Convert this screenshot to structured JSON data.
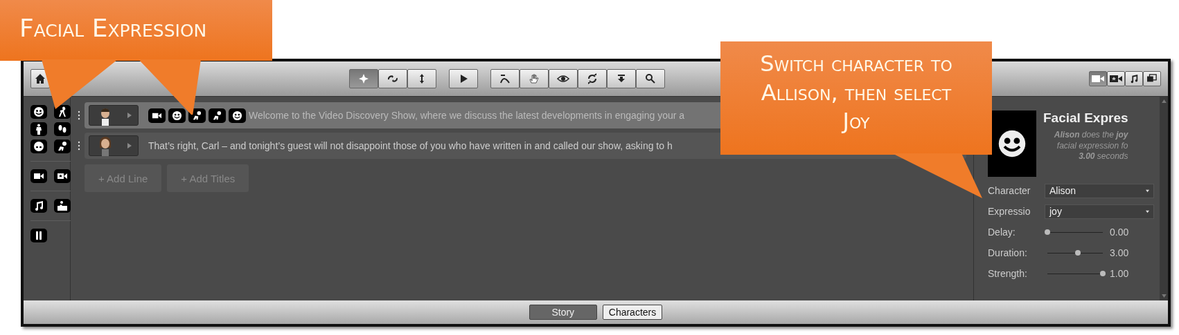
{
  "callouts": [
    {
      "text": "Facial Expression"
    },
    {
      "text": "Switch character to Allison, then select Joy"
    }
  ],
  "toolbar": {
    "mode_buttons": [
      {
        "kind": "move",
        "selected": true
      },
      {
        "kind": "rotate",
        "selected": false
      },
      {
        "kind": "updown",
        "selected": false
      }
    ],
    "view_buttons": [
      {
        "kind": "camera",
        "selected": true
      },
      {
        "kind": "starcam",
        "selected": false
      },
      {
        "kind": "music",
        "selected": false
      },
      {
        "kind": "media",
        "selected": false
      }
    ]
  },
  "palette": [
    {
      "kind": "face"
    },
    {
      "kind": "run"
    },
    {
      "kind": "stand"
    },
    {
      "kind": "steps"
    },
    {
      "kind": "eyes"
    },
    {
      "kind": "crawl"
    },
    {
      "kind": "divider"
    },
    {
      "kind": "camera"
    },
    {
      "kind": "starcam"
    },
    {
      "kind": "divider"
    },
    {
      "kind": "music"
    },
    {
      "kind": "picture"
    },
    {
      "kind": "divider"
    },
    {
      "kind": "pause"
    }
  ],
  "lines": [
    {
      "selected": true,
      "avatar": {
        "kind": "man"
      },
      "actions": [
        {
          "kind": "camera"
        },
        {
          "kind": "face"
        },
        {
          "kind": "crawl"
        },
        {
          "kind": "crawl"
        },
        {
          "kind": "face"
        }
      ],
      "text": "Welcome to the Video Discovery Show, where we discuss the latest developments in engaging your a"
    },
    {
      "selected": false,
      "avatar": {
        "kind": "woman"
      },
      "text": "That’s right, Carl – and tonight’s guest will not disappoint those of you who have written in and called our show, asking to h"
    }
  ],
  "add_buttons": [
    "+ Add Line",
    "+ Add Titles"
  ],
  "inspector": {
    "title": "Facial Expres",
    "description": [
      "**Alison** does the **joy**",
      "facial expression fo",
      "**3.00** seconds"
    ],
    "fields": [
      {
        "label": "Character",
        "value": "Alison"
      },
      {
        "label": "Expressio",
        "value": "joy"
      }
    ],
    "sliders": [
      {
        "label": "Delay:",
        "level": 0,
        "reading": "0.00"
      },
      {
        "label": "Duration:",
        "level": 0.55,
        "reading": "3.00"
      },
      {
        "label": "Strength:",
        "level": 1,
        "reading": "1.00"
      }
    ]
  },
  "bottom_tabs": [
    {
      "label": "Story",
      "selected": true
    },
    {
      "label": "Characters",
      "selected": false
    }
  ]
}
